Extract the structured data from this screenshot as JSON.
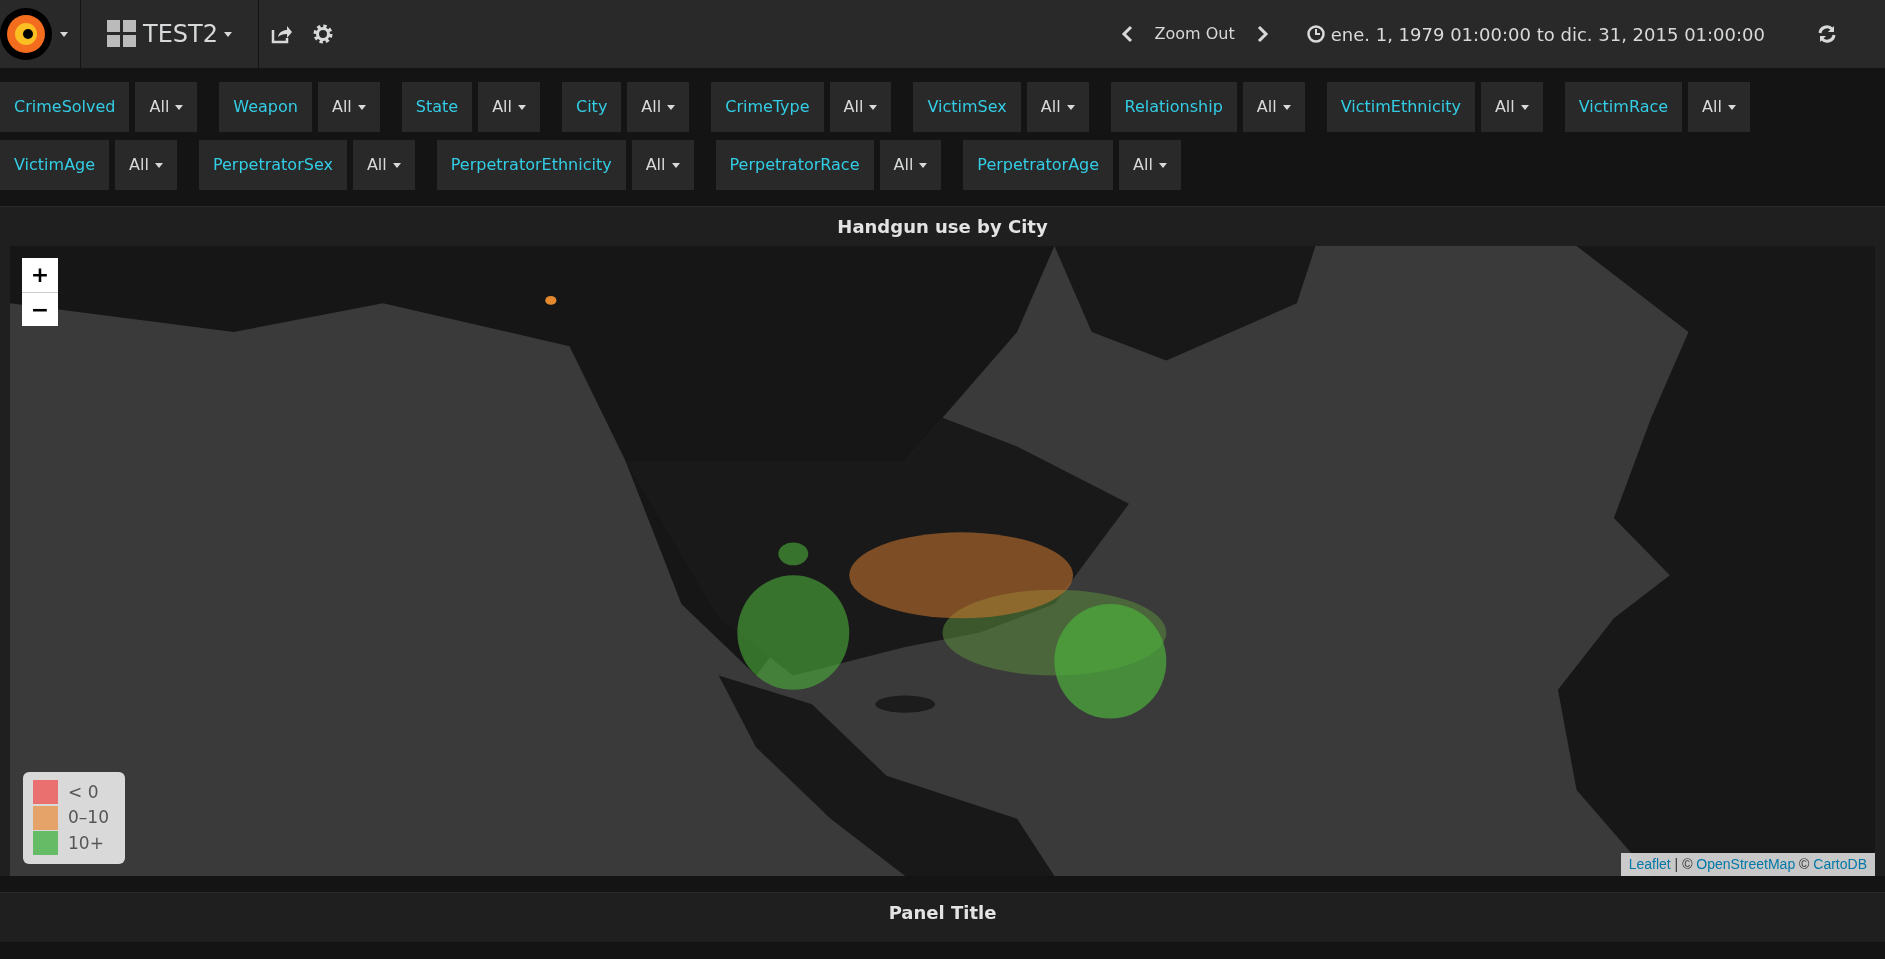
{
  "topbar": {
    "dashboard_title": "TEST2",
    "zoom_label": "Zoom Out",
    "time_range": "ene. 1, 1979 01:00:00 to dic. 31, 2015 01:00:00"
  },
  "filter_rows": [
    [
      {
        "label": "CrimeSolved",
        "value": "All"
      },
      {
        "label": "Weapon",
        "value": "All"
      },
      {
        "label": "State",
        "value": "All"
      },
      {
        "label": "City",
        "value": "All"
      },
      {
        "label": "CrimeType",
        "value": "All"
      },
      {
        "label": "VictimSex",
        "value": "All"
      },
      {
        "label": "Relationship",
        "value": "All"
      },
      {
        "label": "VictimEthnicity",
        "value": "All"
      },
      {
        "label": "VictimRace",
        "value": "All"
      }
    ],
    [
      {
        "label": "VictimAge",
        "value": "All"
      },
      {
        "label": "PerpetratorSex",
        "value": "All"
      },
      {
        "label": "PerpetratorEthnicity",
        "value": "All"
      },
      {
        "label": "PerpetratorRace",
        "value": "All"
      },
      {
        "label": "PerpetratorAge",
        "value": "All"
      }
    ]
  ],
  "map_panel": {
    "title": "Handgun use by City",
    "zoom_in": "+",
    "zoom_out": "−",
    "legend": [
      {
        "label": "< 0",
        "color": "#ea6f6f"
      },
      {
        "label": "0–10",
        "color": "#e5a36a"
      },
      {
        "label": "10+",
        "color": "#66bb66"
      }
    ],
    "attribution": [
      {
        "kind": "link",
        "text": "Leaflet"
      },
      {
        "kind": "text",
        "text": " | © "
      },
      {
        "kind": "link",
        "text": "OpenStreetMap"
      },
      {
        "kind": "text",
        "text": " © "
      },
      {
        "kind": "link",
        "text": "CartoDB"
      }
    ]
  },
  "next_panel": {
    "title": "Panel Title"
  }
}
